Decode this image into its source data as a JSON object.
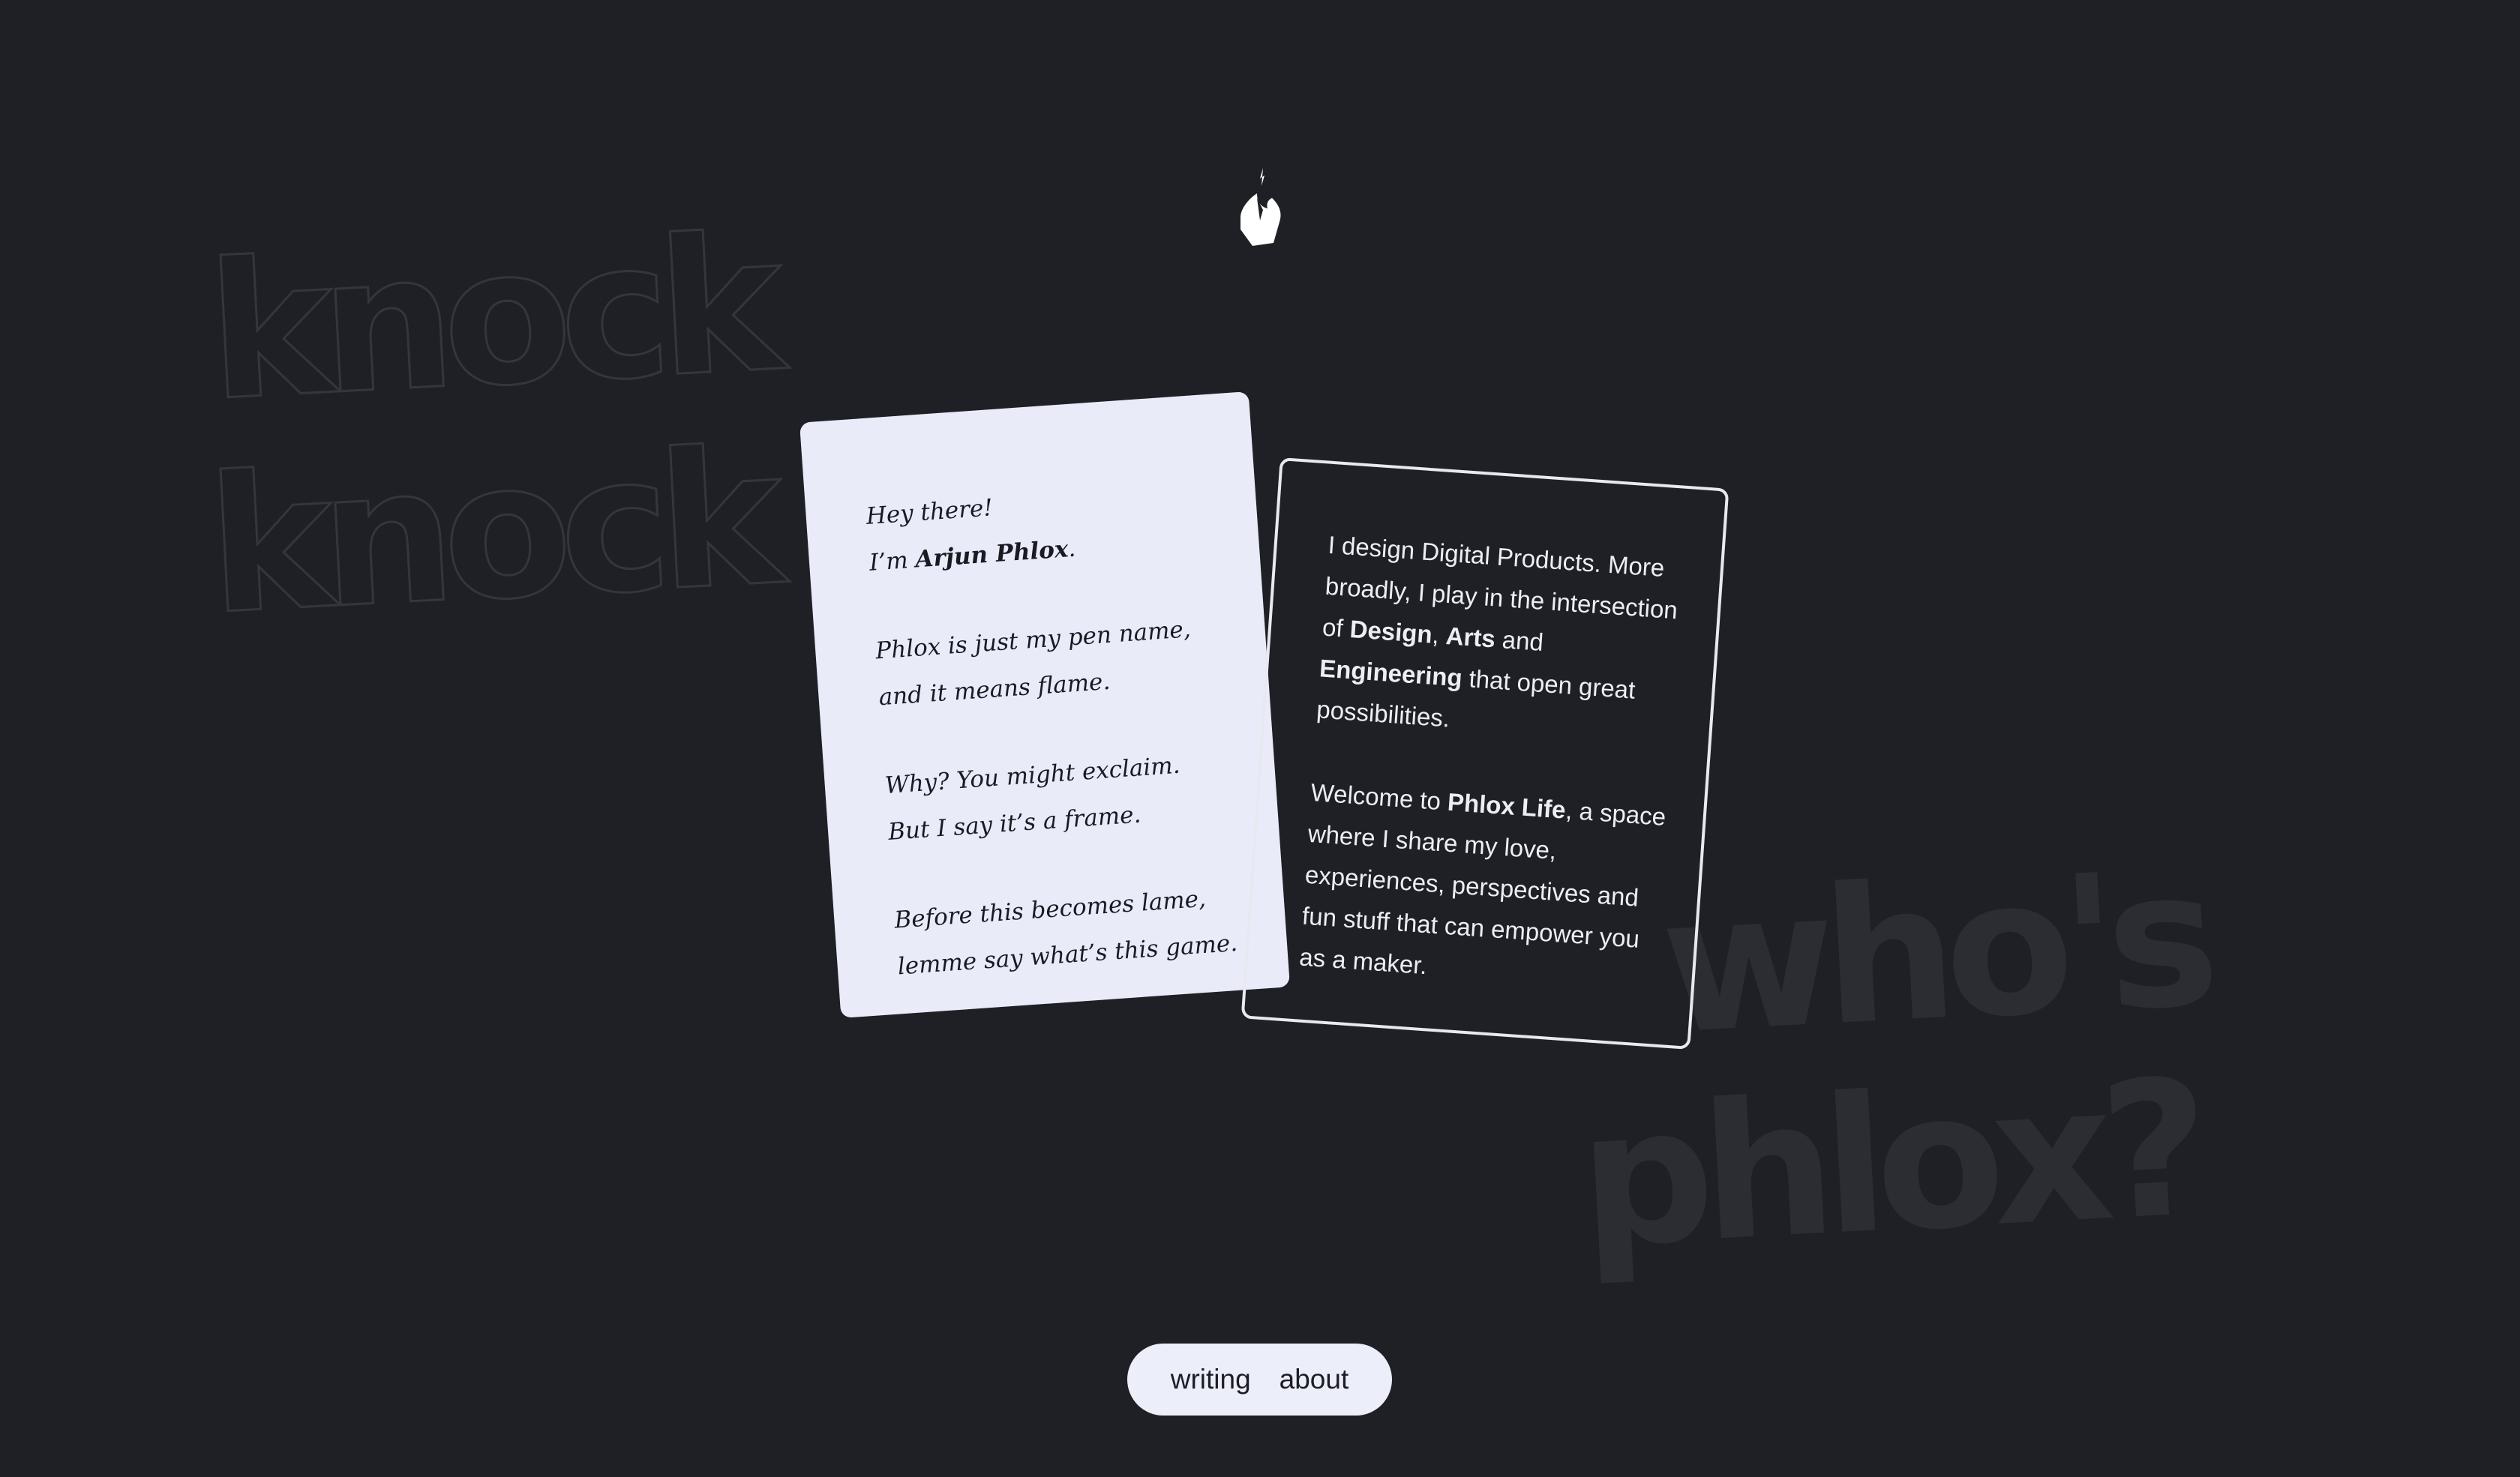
{
  "background": {
    "color": "#1f2025",
    "knock_line_1": "knock",
    "knock_line_2": "knock",
    "whos_line_1": "who's",
    "whos_line_2": "phlox?"
  },
  "logo": {
    "icon": "flame-icon",
    "color": "#ffffff"
  },
  "letter_card": {
    "background": "#e9ebf9",
    "greeting": "Hey there!",
    "intro_prefix": "I’m ",
    "intro_name": "Arjun Phlox",
    "intro_suffix": ".",
    "pen_name_line_1": "Phlox is just my pen name,",
    "pen_name_line_2": "and it means flame.",
    "why_line_1": "Why? You might exclaim.",
    "why_line_2": "But I say it’s a frame.",
    "before_line_1": "Before this becomes lame,",
    "before_line_2": "lemme say what’s this game."
  },
  "bio_card": {
    "border_color": "#e8e9f0",
    "p1_a": "I design Digital Products. More broadly, I play in the intersection of ",
    "p1_design": "Design",
    "p1_comma": ", ",
    "p1_arts": "Arts",
    "p1_and": " and ",
    "p1_engineering": "Engineering",
    "p1_end": " that open great possibilities.",
    "p2_a": "Welcome to ",
    "p2_phlox": "Phlox Life",
    "p2_end": ", a space where I share my love, experiences, perspectives and fun stuff that can empower you as a maker."
  },
  "nav": {
    "writing": "writing",
    "about": "about"
  }
}
